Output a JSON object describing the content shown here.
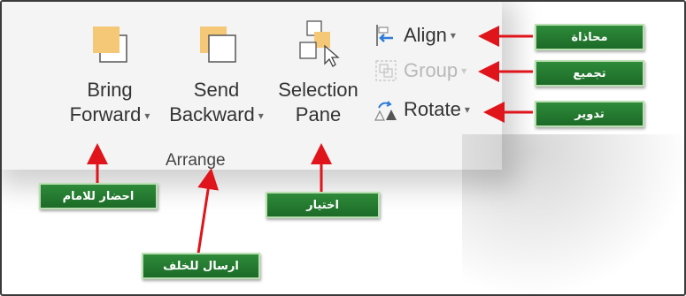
{
  "arrange": {
    "group_label": "Arrange",
    "bring_forward": {
      "line1": "Bring",
      "line2": "Forward",
      "icon": "bring-forward-icon"
    },
    "send_backward": {
      "line1": "Send",
      "line2": "Backward",
      "icon": "send-backward-icon"
    },
    "selection_pane": {
      "line1": "Selection",
      "line2": "Pane",
      "icon": "selection-pane-icon"
    },
    "align": {
      "label": "Align",
      "icon": "align-icon"
    },
    "group": {
      "label": "Group",
      "icon": "group-icon",
      "disabled": true
    },
    "rotate": {
      "label": "Rotate",
      "icon": "rotate-icon"
    },
    "dropdown_caret": "▾"
  },
  "callouts": {
    "align": "محاذاة",
    "group": "تجميع",
    "rotate": "تدوير",
    "bring_forward": "احضار للامام",
    "send_backward": "ارسال للخلف",
    "selection_pane": "اختيار"
  },
  "colors": {
    "arrow": "#e0141b",
    "callout_bg": "#237a30",
    "callout_border": "#b8e0b0",
    "icon_fill": "#f5c878"
  }
}
